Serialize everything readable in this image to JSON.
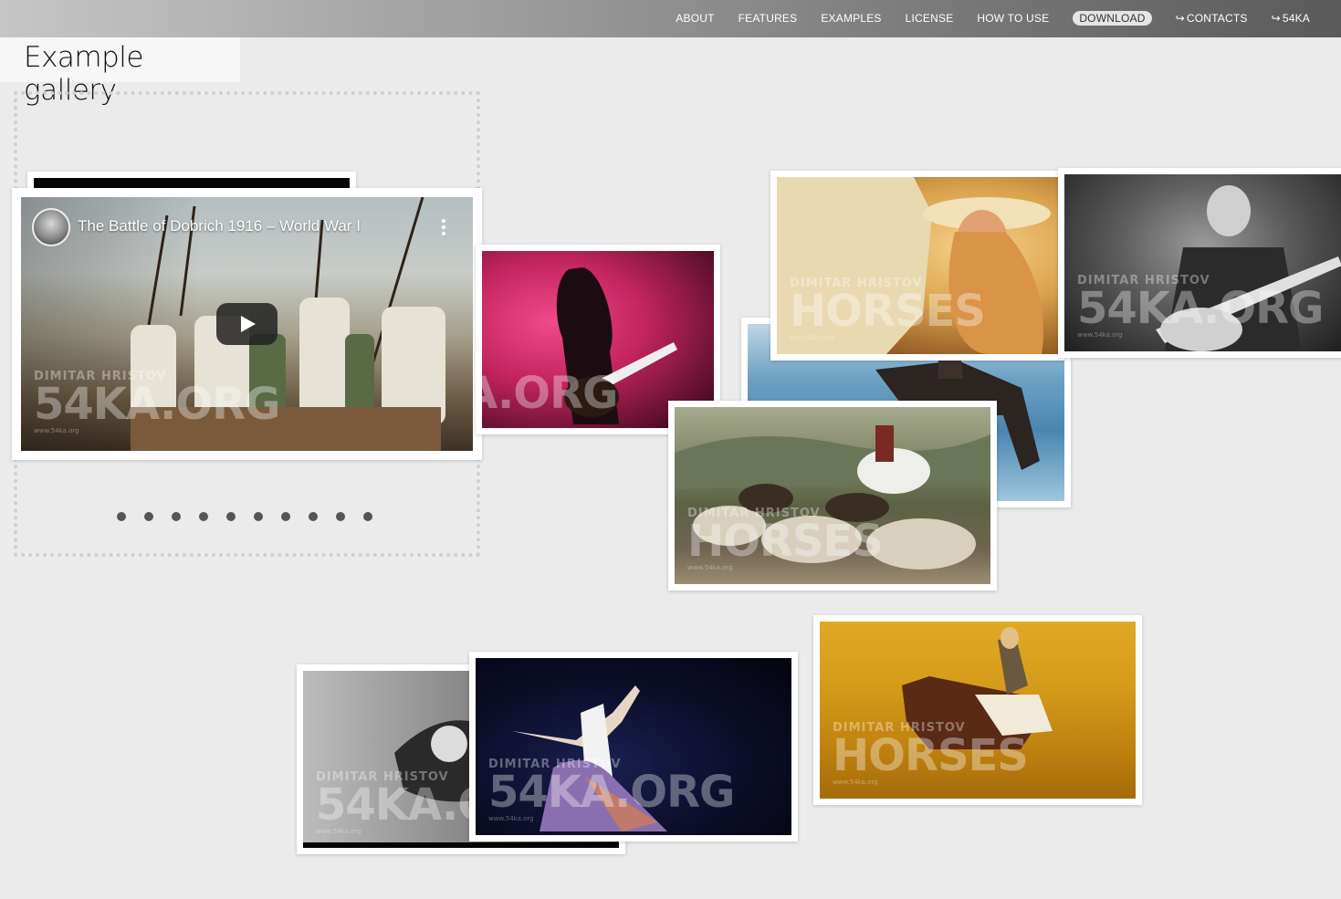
{
  "nav": {
    "items": [
      "ABOUT",
      "FEATURES",
      "EXAMPLES",
      "LICENSE",
      "HOW TO USE",
      "DOWNLOAD"
    ],
    "external": [
      "CONTACTS",
      "54KA"
    ],
    "active": "DOWNLOAD"
  },
  "page": {
    "title": "Example gallery"
  },
  "video": {
    "title": "The Battle of Dobrich 1916 – World War I"
  },
  "watermark": {
    "author": "DIMITAR HRISTOV",
    "brand": "54KA.ORG",
    "horses": "HORSES",
    "url": "www.54ka.org"
  },
  "pager": {
    "dot_count": 10
  },
  "icons": {
    "external_link": "external-link-icon",
    "play": "play-icon",
    "more": "kebab-icon"
  }
}
